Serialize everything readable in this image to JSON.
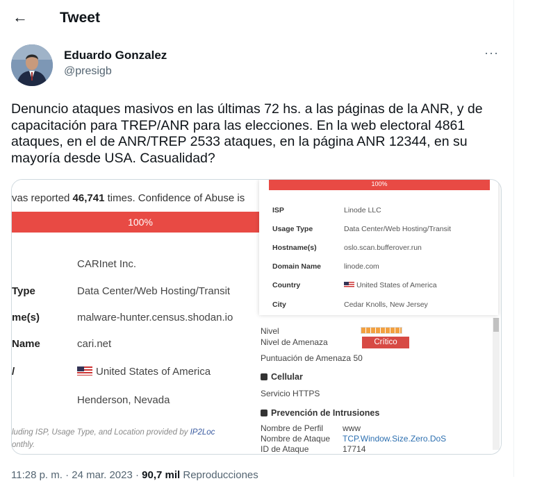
{
  "header": {
    "back_icon": "←",
    "title": "Tweet"
  },
  "author": {
    "name": "Eduardo Gonzalez",
    "handle": "@presigb",
    "more_icon": "···"
  },
  "tweet": {
    "text": "Denuncio ataques masivos en las últimas 72 hs. a las páginas de la ANR, y de capacitación para TREP/ANR para las elecciones. En la web electoral 4861 ataques, en el de ANR/TREP 2533 ataques, en la página ANR 12344, en su mayoría desde USA. Casualidad?"
  },
  "left_shot": {
    "reported_prefix": "vas reported ",
    "reported_count": "46,741",
    "reported_suffix": " times. Confidence of Abuse is",
    "confidence_bar": "100%",
    "rows": [
      {
        "key": "",
        "value": "CARInet Inc."
      },
      {
        "key": "Type",
        "value": "Data Center/Web Hosting/Transit"
      },
      {
        "key": "me(s)",
        "value": "malware-hunter.census.shodan.io"
      },
      {
        "key": "Name",
        "value": "cari.net"
      },
      {
        "key": "/",
        "value": "United States of America"
      },
      {
        "key": "",
        "value": "Henderson, Nevada"
      }
    ],
    "footer_prefix": "luding ISP, Usage Type, and Location provided by ",
    "footer_link": "IP2Loc",
    "footer_line2": "onthly."
  },
  "right_top": {
    "bar": "100%",
    "rows": [
      {
        "key": "ISP",
        "value": "Linode LLC"
      },
      {
        "key": "Usage Type",
        "value": "Data Center/Web Hosting/Transit"
      },
      {
        "key": "Hostname(s)",
        "value": "oslo.scan.bufferover.run"
      },
      {
        "key": "Domain Name",
        "value": "linode.com"
      },
      {
        "key": "Country",
        "value": "United States of America"
      },
      {
        "key": "City",
        "value": "Cedar Knolls, New Jersey"
      }
    ]
  },
  "right_bottom": {
    "nivel_label": "Nivel",
    "amenaza_label": "Nivel de Amenaza",
    "amenaza_value": "Crítico",
    "puntuacion_label": "Puntuación de Amenaza",
    "puntuacion_value": "50",
    "cellular_title": "Cellular",
    "servicio_label": "Servicio",
    "servicio_value": "HTTPS",
    "prevencion_title": "Prevención de Intrusiones",
    "perfil_label": "Nombre de Perfil",
    "perfil_value": "www",
    "ataque_label": "Nombre de Ataque",
    "ataque_value": "TCP.Window.Size.Zero.DoS",
    "id_label": "ID de Ataque",
    "id_value": "17714"
  },
  "meta": {
    "time": "11:28 p. m. · 24 mar. 2023 · ",
    "views": "90,7 mil",
    "views_label": " Reproducciones"
  }
}
